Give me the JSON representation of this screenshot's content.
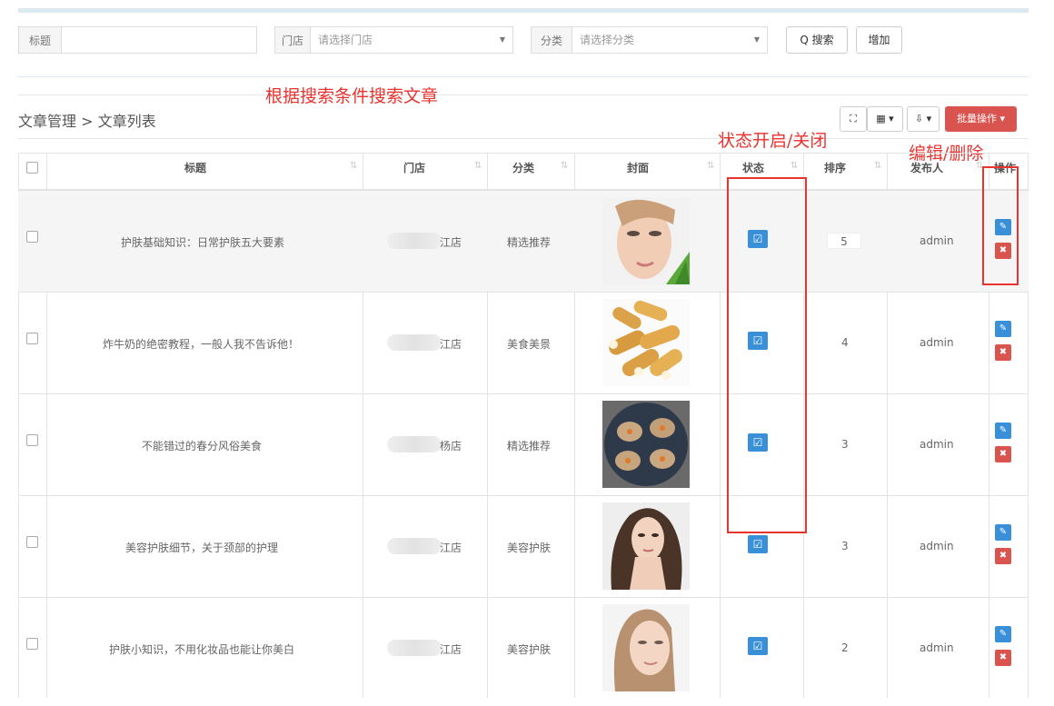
{
  "search": {
    "title_label": "标题",
    "title_placeholder": "",
    "store_label": "门店",
    "store_placeholder": "请选择门店",
    "category_label": "分类",
    "category_placeholder": "请选择分类",
    "search_button": "Q 搜索",
    "add_button": "增加"
  },
  "annotations": {
    "search_note": "根据搜索条件搜索文章",
    "status_note": "状态开启/关闭",
    "action_note": "编辑/删除"
  },
  "breadcrumb": "文章管理 > 文章列表",
  "toolbar": {
    "fullscreen": "⛶",
    "columns": "▦ ▾",
    "export": "⇩ ▾",
    "batch": "批量操作 ▾"
  },
  "table": {
    "headers": {
      "title": "标题",
      "store": "门店",
      "category": "分类",
      "cover": "封面",
      "status": "状态",
      "sort": "排序",
      "publisher": "发布人",
      "actions": "操作"
    },
    "rows": [
      {
        "title": "护肤基础知识：日常护肤五大要素",
        "store_suffix": "江店",
        "category": "精选推荐",
        "cover": "woman-face-portrait",
        "sort": "5",
        "publisher": "admin"
      },
      {
        "title": "炸牛奶的绝密教程，一般人我不告诉他！",
        "store_suffix": "江店",
        "category": "美食美景",
        "cover": "fried-milk-rolls",
        "sort": "4",
        "publisher": "admin"
      },
      {
        "title": "不能错过的春分风俗美食",
        "store_suffix": "杨店",
        "category": "精选推荐",
        "cover": "spring-rolls-plate",
        "sort": "3",
        "publisher": "admin"
      },
      {
        "title": "美容护肤细节，关于颈部的护理",
        "store_suffix": "江店",
        "category": "美容护肤",
        "cover": "woman-neck-portrait",
        "sort": "3",
        "publisher": "admin"
      },
      {
        "title": "护肤小知识，不用化妆品也能让你美白",
        "store_suffix": "江店",
        "category": "美容护肤",
        "cover": "woman-face-closeup",
        "sort": "2",
        "publisher": "admin"
      }
    ]
  },
  "colors": {
    "accent_blue": "#3a8fd9",
    "danger_red": "#d9534f",
    "annotation_red": "#e8332f"
  }
}
